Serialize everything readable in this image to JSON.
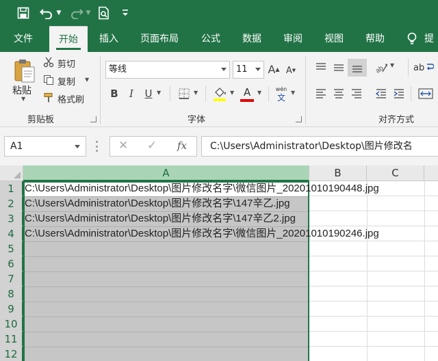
{
  "qat": {
    "icons": [
      "save-icon",
      "undo-icon",
      "redo-icon",
      "print-preview-icon",
      "customize-qat-icon"
    ]
  },
  "tabs": [
    {
      "label": "文件"
    },
    {
      "label": "开始"
    },
    {
      "label": "插入"
    },
    {
      "label": "页面布局"
    },
    {
      "label": "公式"
    },
    {
      "label": "数据"
    },
    {
      "label": "审阅"
    },
    {
      "label": "视图"
    },
    {
      "label": "帮助"
    },
    {
      "label": "提"
    }
  ],
  "ribbon": {
    "clipboard": {
      "paste_label": "粘贴",
      "cut_label": "剪切",
      "copy_label": "复制",
      "format_painter_label": "格式刷",
      "group_label": "剪贴板"
    },
    "font": {
      "font_name": "等线",
      "font_size": "11",
      "bold": "B",
      "italic": "I",
      "underline": "U",
      "grow": "A",
      "shrink": "A",
      "font_color_letter": "A",
      "phonetic_top": "wén",
      "phonetic_bottom": "文",
      "group_label": "字体"
    },
    "alignment": {
      "group_label": "对齐方式",
      "wrap_label": "ab"
    }
  },
  "formula_bar": {
    "name_box": "A1",
    "cancel": "✕",
    "enter": "✓",
    "fx": "fx",
    "content": "C:\\Users\\Administrator\\Desktop\\图片修改名"
  },
  "grid": {
    "columns": [
      "A",
      "B",
      "C"
    ],
    "rows": [
      "1",
      "2",
      "3",
      "4",
      "5",
      "6",
      "7",
      "8",
      "9",
      "10",
      "11",
      "12"
    ],
    "cells": [
      "C:\\Users\\Administrator\\Desktop\\图片修改名字\\微信图片_20201010190448.jpg",
      "C:\\Users\\Administrator\\Desktop\\图片修改名字\\147辛乙.jpg",
      "C:\\Users\\Administrator\\Desktop\\图片修改名字\\147辛乙2.jpg",
      "C:\\Users\\Administrator\\Desktop\\图片修改名字\\微信图片_20201010190246.jpg"
    ]
  },
  "colors": {
    "accent": "#217346",
    "selection_fill": "#c6c6c6",
    "header_selected": "#a9d5b6",
    "fill_color_bar": "#ffff00",
    "font_color_bar": "#e00000"
  }
}
